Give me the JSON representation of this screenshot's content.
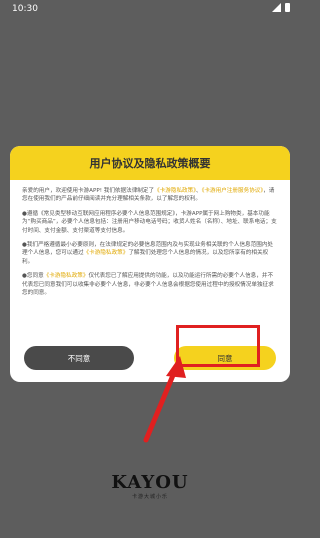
{
  "status_bar": {
    "time": "10:30"
  },
  "dialog": {
    "title": "用户协议及隐私政策概要",
    "para1_a": "亲爱的用户，欢迎使用卡游APP! 我们依据法律制定了",
    "link_privacy": "《卡游隐私政策》",
    "para1_b": "、",
    "link_user_agreement": "《卡游用户注册服务协议》",
    "para1_c": "，请您在使用我们的产品前仔细阅读并充分理解相关条款，以了解您的权利。",
    "para2": "●遵循《常见类型移动互联网应用程序必要个人信息范围规定》，卡游APP属于网上购物类，基本功能为“购买商品”，必要个人信息包括：注册用户移动电话号码；收货人姓名（名称）、地址、联系电话；支付时间、支付金额、支付渠道等支付信息。",
    "para3_a": "●我们严格遵循最小必要原则，在法律规定的必要信息范围内及与实现业务相关联的个人信息范围内处理个人信息，您可以通过",
    "link_privacy_2": "《卡游隐私政策》",
    "para3_b": "了解我们处理您个人信息的情况，以及您所享有的相关权利。",
    "para4_a": "●您同意",
    "link_privacy_3": "《卡游隐私政策》",
    "para4_b": "仅代表您已了解应用提供的功能，以及功能运行所需的必要个人信息，并不代表您已同意我们可以收集非必要个人信息，非必要个人信息会根据您使用过程中的授权情况单独征求您的同意。",
    "decline_label": "不同意",
    "agree_label": "同意"
  },
  "branding": {
    "logo_text": "KAYOU",
    "logo_sub": "卡游大城小乐"
  },
  "colors": {
    "accent": "#f5d21e",
    "highlight": "#e02020",
    "background": "#5d5d5d"
  }
}
